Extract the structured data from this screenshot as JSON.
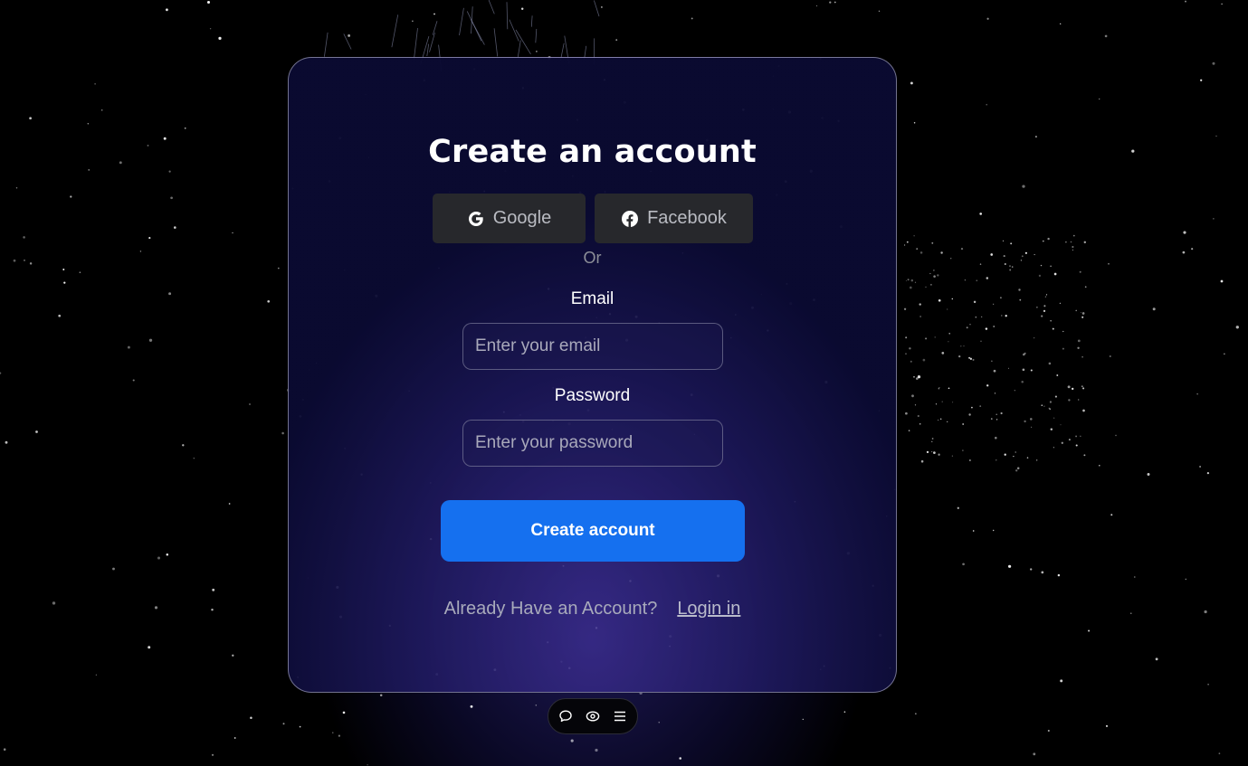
{
  "form": {
    "title": "Create an account",
    "social": {
      "google_label": "Google",
      "facebook_label": "Facebook"
    },
    "divider_text": "Or",
    "email": {
      "label": "Email",
      "placeholder": "Enter your email",
      "value": ""
    },
    "password": {
      "label": "Password",
      "placeholder": "Enter your password",
      "value": ""
    },
    "submit_label": "Create account",
    "footer": {
      "prompt": "Already Have an Account?",
      "link_label": "Login in"
    }
  },
  "toolbar": {
    "icons": [
      "chat-bubble-icon",
      "eye-icon",
      "menu-icon"
    ]
  },
  "colors": {
    "accent": "#1570ef",
    "social_button_bg": "#27282c",
    "background": "#000000",
    "card_border": "#c8c8dc"
  }
}
